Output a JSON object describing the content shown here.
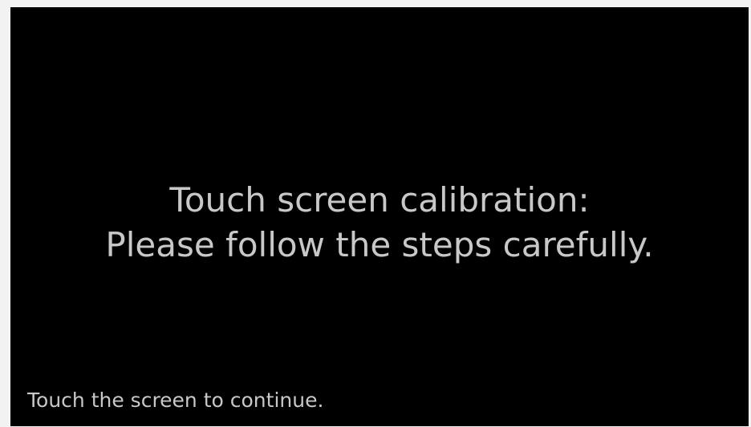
{
  "calibration": {
    "title_line1": "Touch screen calibration:",
    "title_line2": "Please follow the steps carefully.",
    "hint": "Touch the screen to continue."
  },
  "colors": {
    "screen_background": "#000000",
    "text": "#c8c8c8",
    "frame": "#f2f2f2"
  }
}
